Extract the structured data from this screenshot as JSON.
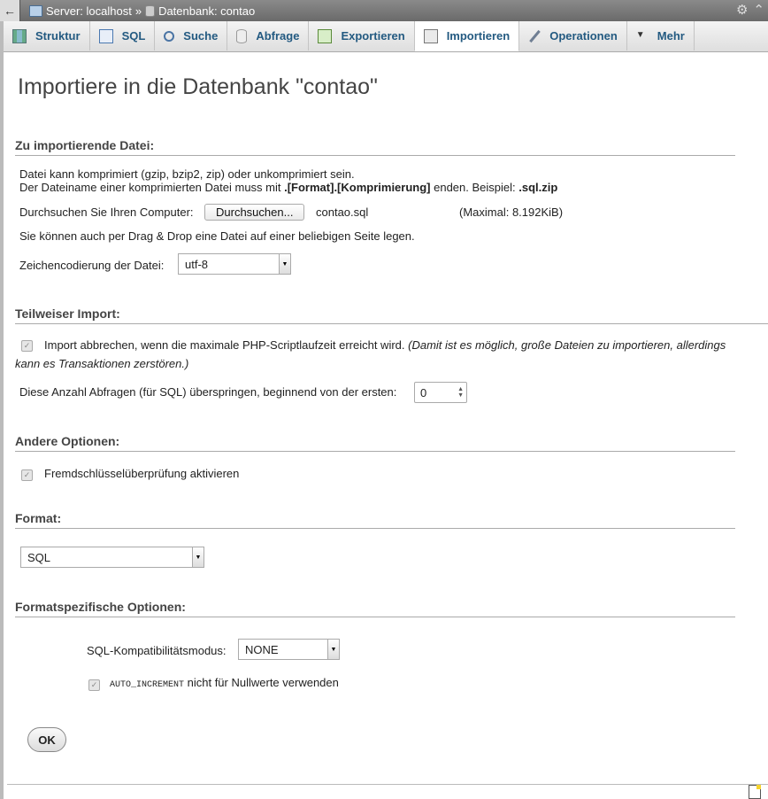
{
  "breadcrumb": {
    "server": "Server: localhost",
    "separator": "»",
    "database": "Datenbank: contao"
  },
  "tabs": [
    {
      "label": "Struktur",
      "icon": "structure-icon"
    },
    {
      "label": "SQL",
      "icon": "sql-icon"
    },
    {
      "label": "Suche",
      "icon": "search-icon"
    },
    {
      "label": "Abfrage",
      "icon": "query-icon"
    },
    {
      "label": "Exportieren",
      "icon": "export-icon"
    },
    {
      "label": "Importieren",
      "icon": "import-icon",
      "active": true
    },
    {
      "label": "Operationen",
      "icon": "wrench-icon"
    },
    {
      "label": "Mehr",
      "icon": "chevron-down-icon"
    }
  ],
  "page_title": "Importiere in die Datenbank \"contao\"",
  "file_section": {
    "legend": "Zu importierende Datei:",
    "info_line1": "Datei kann komprimiert (gzip, bzip2, zip) oder unkomprimiert sein.",
    "info_line2_prefix": "Der Dateiname einer komprimierten Datei muss mit ",
    "info_line2_bold": ".[Format].[Komprimierung]",
    "info_line2_mid": " enden. Beispiel: ",
    "info_line2_example": ".sql.zip",
    "browse_label": "Durchsuchen Sie Ihren Computer:",
    "browse_button": "Durchsuchen...",
    "file_name": "contao.sql",
    "max_size": "(Maximal: 8.192KiB)",
    "dragdrop_text": "Sie können auch per Drag & Drop eine Datei auf einer beliebigen Seite legen.",
    "charset_label": "Zeichencodierung der Datei:",
    "charset_value": "utf-8"
  },
  "partial_section": {
    "legend": "Teilweiser Import:",
    "abort_text": "Import abbrechen, wenn die maximale PHP-Scriptlaufzeit erreicht wird.",
    "abort_note_1": "(Damit ist es möglich, große Dateien zu importieren, allerdings",
    "abort_note_2": "kann es Transaktionen zerstören.)",
    "skip_label": "Diese Anzahl Abfragen (für SQL) überspringen, beginnend von der ersten:",
    "skip_value": "0"
  },
  "other_section": {
    "legend": "Andere Optionen:",
    "fk_label": "Fremdschlüsselüberprüfung aktivieren"
  },
  "format_section": {
    "legend": "Format:",
    "format_value": "SQL"
  },
  "format_specific": {
    "legend": "Formatspezifische Optionen:",
    "compat_label": "SQL-Kompatibilitätsmodus:",
    "compat_value": "NONE",
    "auto_inc_code": "AUTO_INCREMENT",
    "auto_inc_text": " nicht für Nullwerte verwenden"
  },
  "ok_button": "OK"
}
